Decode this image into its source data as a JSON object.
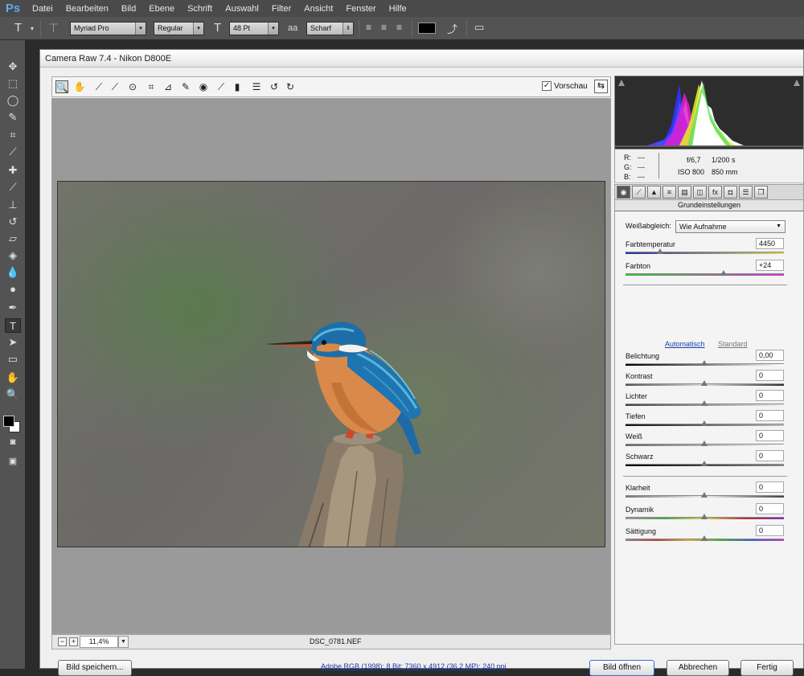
{
  "app": {
    "logo": "Ps"
  },
  "menu": [
    "Datei",
    "Bearbeiten",
    "Bild",
    "Ebene",
    "Schrift",
    "Auswahl",
    "Filter",
    "Ansicht",
    "Fenster",
    "Hilfe"
  ],
  "options": {
    "font_family": "Myriad Pro",
    "font_style": "Regular",
    "font_size": "48 Pt",
    "antialias": "Scharf",
    "text_color": "#000000"
  },
  "camera_raw": {
    "title": "Camera Raw 7.4 - Nikon D800E",
    "preview_label": "Vorschau",
    "preview_checked": true,
    "zoom": "11,4%",
    "filename": "DSC_0781.NEF",
    "readout": {
      "r_label": "R:",
      "r_value": "---",
      "g_label": "G:",
      "g_value": "---",
      "b_label": "B:",
      "b_value": "---",
      "aperture": "f/6,7",
      "shutter": "1/200 s",
      "iso": "ISO 800",
      "focal": "850 mm"
    },
    "panel_title": "Grundeinstellungen",
    "white_balance_label": "Weißabgleich:",
    "white_balance_value": "Wie Aufnahme",
    "auto_label": "Automatisch",
    "default_label": "Standard",
    "sliders": {
      "temperature": {
        "label": "Farbtemperatur",
        "value": "4450",
        "position": 0.22
      },
      "tint": {
        "label": "Farbton",
        "value": "+24",
        "position": 0.62
      },
      "exposure": {
        "label": "Belichtung",
        "value": "0,00",
        "position": 0.5
      },
      "contrast": {
        "label": "Kontrast",
        "value": "0",
        "position": 0.5
      },
      "highlights": {
        "label": "Lichter",
        "value": "0",
        "position": 0.5
      },
      "shadows": {
        "label": "Tiefen",
        "value": "0",
        "position": 0.5
      },
      "whites": {
        "label": "Weiß",
        "value": "0",
        "position": 0.5
      },
      "blacks": {
        "label": "Schwarz",
        "value": "0",
        "position": 0.5
      },
      "clarity": {
        "label": "Klarheit",
        "value": "0",
        "position": 0.5
      },
      "vibrance": {
        "label": "Dynamik",
        "value": "0",
        "position": 0.5
      },
      "saturation": {
        "label": "Sättigung",
        "value": "0",
        "position": 0.5
      }
    },
    "buttons": {
      "save": "Bild speichern...",
      "open": "Bild öffnen",
      "cancel": "Abbrechen",
      "done": "Fertig"
    },
    "workflow_info": "Adobe RGB (1998); 8 Bit; 7360 x 4912 (36,2 MP); 240 ppi"
  }
}
